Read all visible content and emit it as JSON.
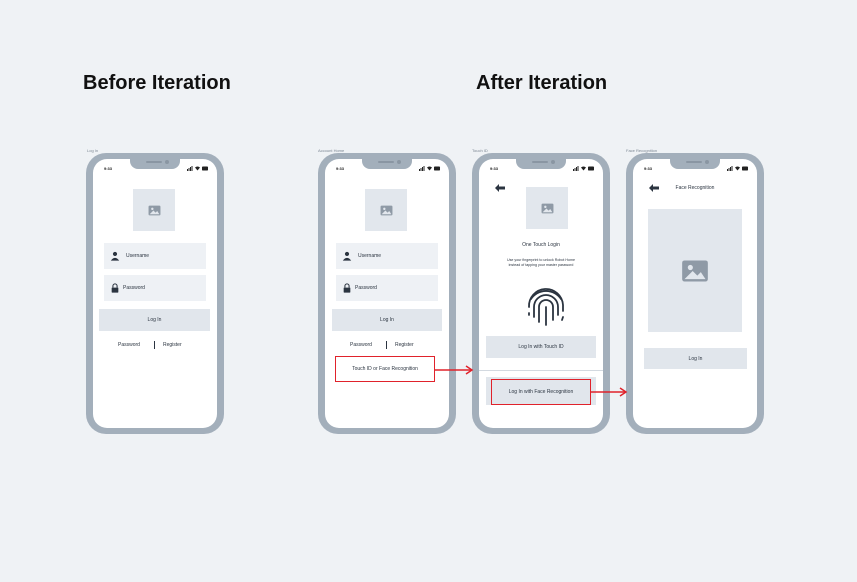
{
  "headings": {
    "before": "Before Iteration",
    "after": "After Iteration"
  },
  "screens": {
    "before_login": {
      "label": "Log In",
      "time": "9:33",
      "username_label": "Username",
      "password_label": "Password",
      "login_button": "Log In",
      "link_password": "Password",
      "link_register": "Register"
    },
    "account_home": {
      "label": "Account Home",
      "time": "9:33",
      "username_label": "Username",
      "password_label": "Password",
      "login_button": "Log In",
      "link_password": "Password",
      "link_register": "Register",
      "alt_login": "Touch ID or Face Recognition"
    },
    "touch_id": {
      "label": "Touch ID",
      "time": "9:33",
      "title": "One Touch Login",
      "description_line1": "Use your fingerprint to unlock Robot Home",
      "description_line2": "instead of tapping your master password",
      "touch_button": "Log In with Touch ID",
      "face_button": "Log In with Face Recognition"
    },
    "face_recognition": {
      "label": "Face Recognition",
      "time": "9:33",
      "title": "Face Recognition",
      "login_button": "Log In"
    }
  },
  "colors": {
    "background": "#eff2f5",
    "phone_frame": "#a3afbb",
    "placeholder": "#e2e7ed",
    "highlight": "#e0222b"
  },
  "icons": [
    "image-icon",
    "user-icon",
    "lock-icon",
    "back-arrow-icon",
    "fingerprint-icon",
    "signal-icon",
    "wifi-icon",
    "battery-icon"
  ]
}
